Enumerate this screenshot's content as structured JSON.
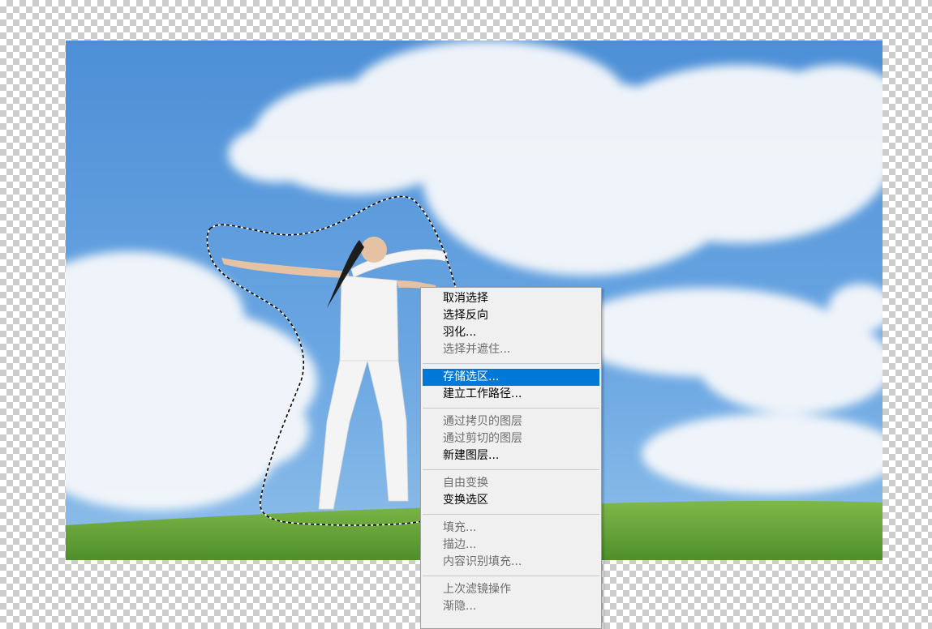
{
  "canvas": {
    "subject": "woman in white with outstretched arms on grassy hill under cloudy blue sky",
    "selection": "marching-ants freeform selection around the woman"
  },
  "colors": {
    "menu_background": "#f0f0f0",
    "menu_highlight": "#0078d7",
    "menu_disabled_text": "#6d6d6d"
  },
  "context_menu": {
    "groups": [
      {
        "items": [
          {
            "label": "取消选择",
            "enabled": true
          },
          {
            "label": "选择反向",
            "enabled": true
          },
          {
            "label": "羽化...",
            "enabled": true
          },
          {
            "label": "选择并遮住...",
            "enabled": false
          }
        ]
      },
      {
        "items": [
          {
            "label": "存储选区...",
            "enabled": true,
            "highlighted": true
          },
          {
            "label": "建立工作路径...",
            "enabled": true
          }
        ]
      },
      {
        "items": [
          {
            "label": "通过拷贝的图层",
            "enabled": false
          },
          {
            "label": "通过剪切的图层",
            "enabled": false
          },
          {
            "label": "新建图层...",
            "enabled": true
          }
        ]
      },
      {
        "items": [
          {
            "label": "自由变换",
            "enabled": false
          },
          {
            "label": "变换选区",
            "enabled": true
          }
        ]
      },
      {
        "items": [
          {
            "label": "填充...",
            "enabled": false
          },
          {
            "label": "描边...",
            "enabled": false
          },
          {
            "label": "内容识别填充...",
            "enabled": false
          }
        ]
      },
      {
        "items": [
          {
            "label": "上次滤镜操作",
            "enabled": false
          },
          {
            "label": "渐隐...",
            "enabled": false
          }
        ]
      }
    ]
  }
}
